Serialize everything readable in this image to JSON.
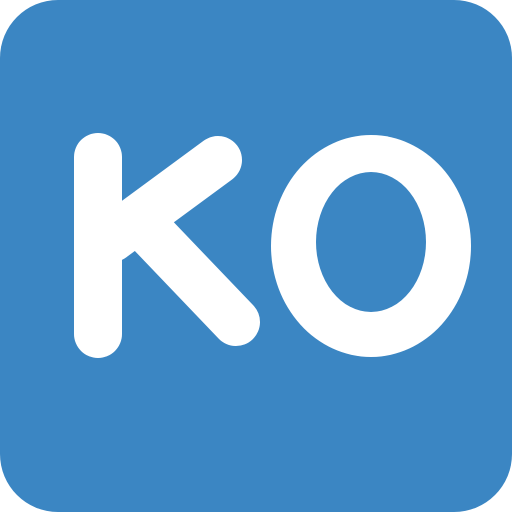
{
  "icon": {
    "name": "ko-letters-icon",
    "text": "KO",
    "background_color": "#3b86c3",
    "letter_color": "#ffffff"
  }
}
